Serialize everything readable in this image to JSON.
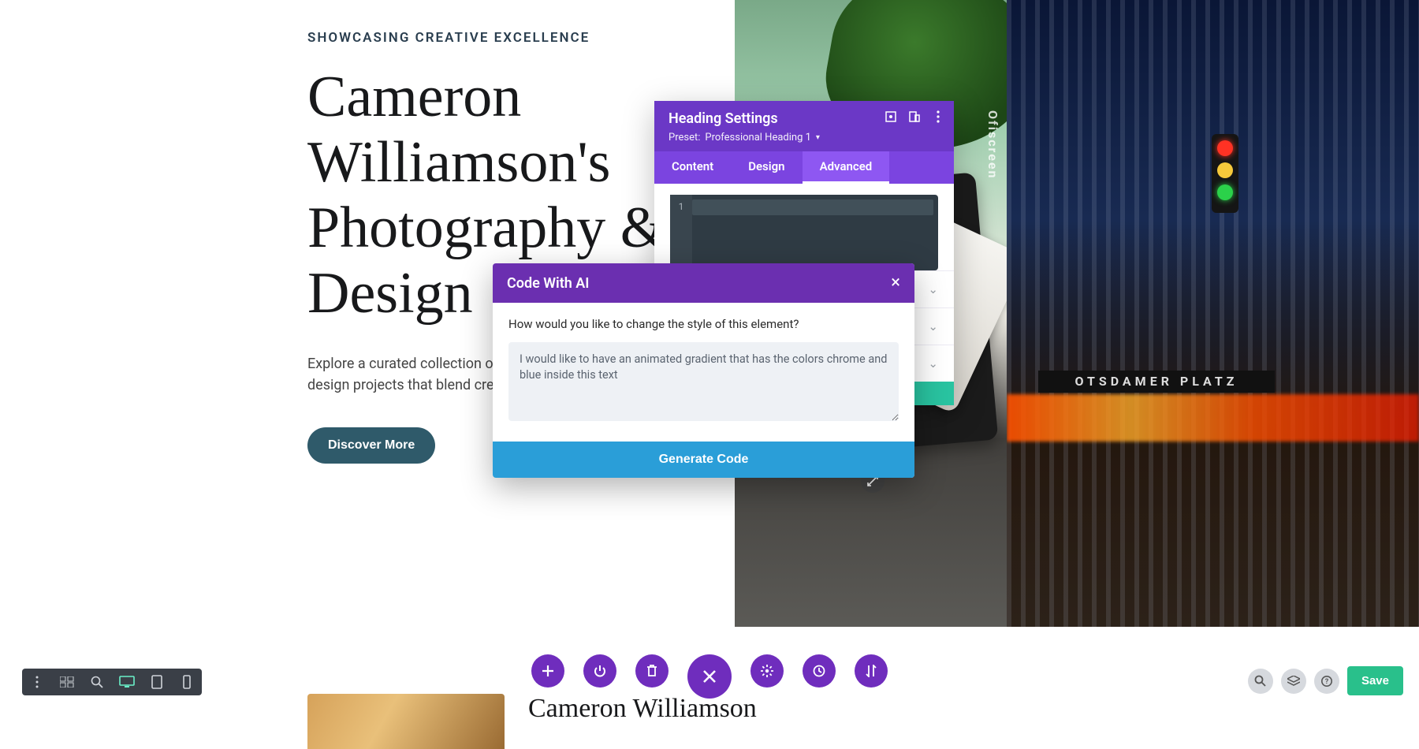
{
  "hero": {
    "eyebrow": "SHOWCASING CREATIVE EXCELLENCE",
    "title": "Cameron Williamson's Photography & Design",
    "description": "Explore a curated collection of visual storytelling and innovative design projects that blend creativity and precision.",
    "cta": "Discover More"
  },
  "right_image": {
    "sign_text": "OTSDAMER  PLATZ",
    "watermark": "Ofiscreen"
  },
  "settings_panel": {
    "title": "Heading Settings",
    "preset_label": "Preset:",
    "preset_value": "Professional Heading 1",
    "tabs": {
      "content": "Content",
      "design": "Design",
      "advanced": "Advanced"
    },
    "code_first_line": "1"
  },
  "ai_modal": {
    "title": "Code With AI",
    "prompt": "How would you like to change the style of this element?",
    "input_value": "I would like to have an animated gradient that has the colors chrome and blue inside this text",
    "generate": "Generate Code"
  },
  "second": {
    "title": "Cameron Williamson"
  },
  "save_label": "Save"
}
